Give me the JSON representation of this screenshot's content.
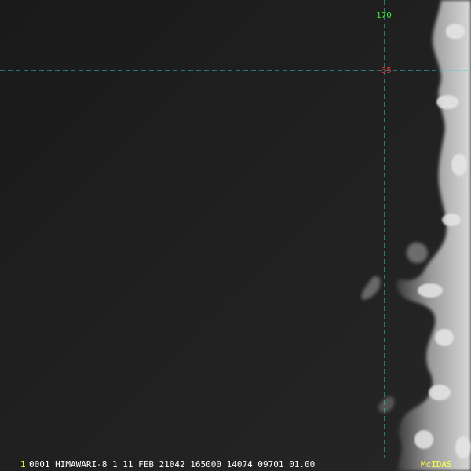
{
  "grid": {
    "longitude_label": "170",
    "latitude_label": "-35",
    "color": "#2ad4d4",
    "longitude_label_color": "#35e635",
    "latitude_label_color": "#e03030"
  },
  "status_bar": {
    "frame": "1",
    "text": "0001 HIMAWARI-8  1 11 FEB 21042 165000 14074 09701 01.00",
    "frame_color": "#ffff40",
    "text_color": "#ffffff",
    "brand": "McIDAS",
    "brand_color": "#ffff40"
  }
}
